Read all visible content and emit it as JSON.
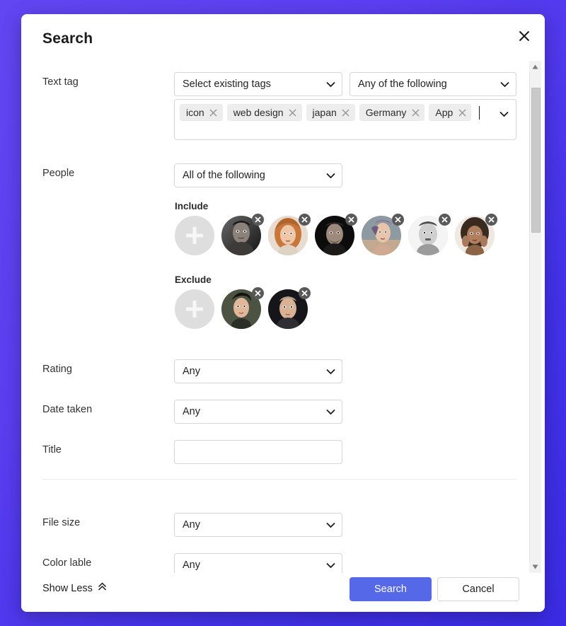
{
  "background": {
    "color_top_left": "#6246f2",
    "color_bottom_right": "#3a2ce4"
  },
  "dialog": {
    "title": "Search",
    "close_icon": "close-icon"
  },
  "fields": {
    "text_tag": {
      "label": "Text tag",
      "tag_source_select": "Select existing tags",
      "match_select": "Any of the following",
      "chips": [
        "icon",
        "web design",
        "japan",
        "Germany",
        "App"
      ]
    },
    "people": {
      "label": "People",
      "match_select": "All of the following",
      "include_label": "Include",
      "exclude_label": "Exclude",
      "add_label": "+",
      "include_count": 6,
      "exclude_count": 2
    },
    "rating": {
      "label": "Rating",
      "value": "Any"
    },
    "date_taken": {
      "label": "Date taken",
      "value": "Any"
    },
    "title": {
      "label": "Title",
      "value": "",
      "placeholder": ""
    },
    "file_size": {
      "label": "File size",
      "value": "Any"
    },
    "color_lable": {
      "label": "Color lable",
      "value": "Any"
    }
  },
  "footer": {
    "show_less": "Show Less",
    "show_less_icon": "chevron-double-up-icon",
    "search_button": "Search",
    "cancel_button": "Cancel",
    "primary_color": "#5568e8"
  },
  "scrollbar": {
    "up_icon": "triangle-up-icon",
    "down_icon": "triangle-down-icon",
    "thumb_position_percent": 3
  }
}
